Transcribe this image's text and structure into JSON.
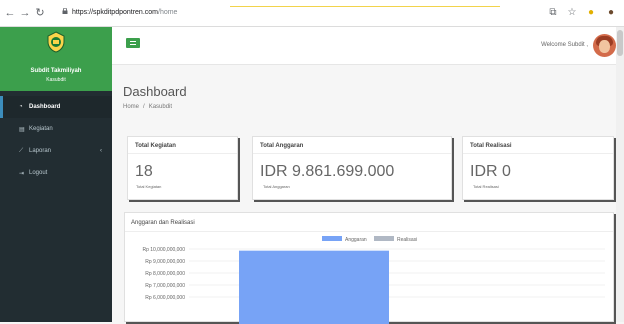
{
  "browser": {
    "url_domain": "https://spkditpdpontren.com",
    "url_path": "/home",
    "back_icon": "back-arrow-icon",
    "forward_icon": "forward-arrow-icon",
    "reload_icon": "reload-icon",
    "lock_icon": "lock-icon"
  },
  "sidebar": {
    "brand_name": "Subdit Takmiliyah",
    "brand_role": "Kasubdit",
    "items": [
      {
        "label": "Dashboard",
        "icon": "dashboard-icon",
        "active": true
      },
      {
        "label": "Kegiatan",
        "icon": "briefcase-icon",
        "active": false
      },
      {
        "label": "Laporan",
        "icon": "chart-icon",
        "active": false
      },
      {
        "label": "Logout",
        "icon": "logout-icon",
        "active": false
      }
    ]
  },
  "header": {
    "welcome": "Welcome Subdit ,"
  },
  "page": {
    "title": "Dashboard",
    "breadcrumb": [
      "Home",
      "Kasubdit"
    ]
  },
  "cards": [
    {
      "title": "Total Kegiatan",
      "value": "18",
      "sub": "Total Kegiatan"
    },
    {
      "title": "Total Anggaran",
      "value": "IDR 9.861.699.000",
      "sub": "Total Anggaran"
    },
    {
      "title": "Total Realisasi",
      "value": "IDR 0",
      "sub": "Total Realisasi"
    }
  ],
  "chart": {
    "title": "Anggaran dan Realisasi"
  },
  "chart_data": {
    "type": "bar",
    "categories": [
      ""
    ],
    "series": [
      {
        "name": "Anggaran",
        "values": [
          9861699000
        ],
        "color": "#77a3f6"
      },
      {
        "name": "Realisasi",
        "values": [
          0
        ],
        "color": "#b0b8c4"
      }
    ],
    "y_tick_labels": [
      "Rp 10,000,000,000",
      "Rp 9,000,000,000",
      "Rp 8,000,000,000",
      "Rp 7,000,000,000",
      "Rp 6,000,000,000"
    ],
    "ylim": [
      5000000000,
      10000000000
    ],
    "legend": "top-center",
    "grid": true
  }
}
